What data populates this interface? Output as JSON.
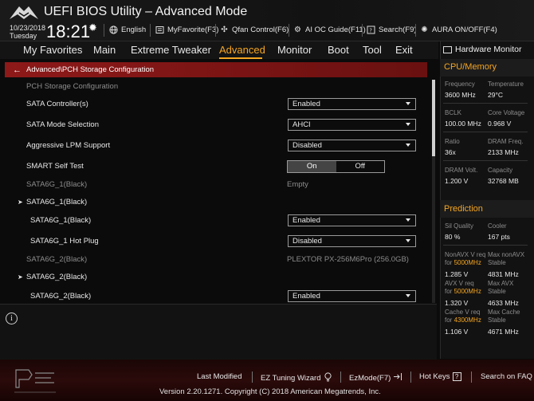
{
  "titlebar": {
    "title": "UEFI BIOS Utility – Advanced Mode",
    "date": "10/23/2018",
    "weekday": "Tuesday",
    "time": "18:21",
    "items": [
      {
        "label": "English",
        "icon": "globe-icon"
      },
      {
        "label": "MyFavorite(F3)",
        "icon": "favorite-icon"
      },
      {
        "label": "Qfan Control(F6)",
        "icon": "fan-icon"
      },
      {
        "label": "AI OC Guide(F11)",
        "icon": "ai-oc-icon"
      },
      {
        "label": "Search(F9)",
        "icon": "search-icon"
      },
      {
        "label": "AURA ON/OFF(F4)",
        "icon": "aura-icon"
      }
    ]
  },
  "menu": {
    "items": [
      "My Favorites",
      "Main",
      "Extreme Tweaker",
      "Advanced",
      "Monitor",
      "Boot",
      "Tool",
      "Exit"
    ],
    "active": "Advanced"
  },
  "breadcrumb": "Advanced\\PCH Storage Configuration",
  "section_title": "PCH Storage Configuration",
  "rows": [
    {
      "label": "SATA Controller(s)",
      "type": "select",
      "value": "Enabled"
    },
    {
      "label": "SATA Mode Selection",
      "type": "select",
      "value": "AHCI"
    },
    {
      "label": "Aggressive LPM Support",
      "type": "select",
      "value": "Disabled"
    },
    {
      "label": "SMART Self Test",
      "type": "toggle",
      "on": "On",
      "off": "Off"
    },
    {
      "label": "SATA6G_1(Black)",
      "type": "info",
      "value": "Empty"
    },
    {
      "label": "SATA6G_1(Black)",
      "type": "group"
    },
    {
      "label": "SATA6G_1(Black)",
      "type": "select",
      "value": "Enabled"
    },
    {
      "label": "SATA6G_1 Hot Plug",
      "type": "select",
      "value": "Disabled"
    },
    {
      "label": "SATA6G_2(Black)",
      "type": "info",
      "value": "PLEXTOR PX-256M6Pro (256.0GB)"
    },
    {
      "label": "SATA6G_2(Black)",
      "type": "group"
    },
    {
      "label": "SATA6G_2(Black)",
      "type": "select",
      "value": "Enabled"
    }
  ],
  "hw_monitor": {
    "title": "Hardware Monitor",
    "cpu_memory": {
      "title": "CPU/Memory",
      "frequency_label": "Frequency",
      "frequency": "3600 MHz",
      "temperature_label": "Temperature",
      "temperature": "29°C",
      "bclk_label": "BCLK",
      "bclk": "100.00 MHz",
      "core_voltage_label": "Core Voltage",
      "core_voltage": "0.968 V",
      "ratio_label": "Ratio",
      "ratio": "36x",
      "dram_freq_label": "DRAM Freq.",
      "dram_freq": "2133 MHz",
      "dram_volt_label": "DRAM Volt.",
      "dram_volt": "1.200 V",
      "capacity_label": "Capacity",
      "capacity": "32768 MB"
    },
    "prediction": {
      "title": "Prediction",
      "sil_quality_label": "Sil Quality",
      "sil_quality": "80 %",
      "cooler_label": "Cooler",
      "cooler": "167 pts",
      "nonavx_req_label": "NonAVX V req",
      "nonavx_for": "for",
      "nonavx_freq": "5000MHz",
      "nonavx_v": "1.285 V",
      "max_nonavx_label": "Max nonAVX",
      "max_nonavx_state": "Stable",
      "max_nonavx": "4831 MHz",
      "avx_req_label": "AVX V req",
      "avx_for": "for",
      "avx_freq": "5000MHz",
      "avx_v": "1.320 V",
      "max_avx_label": "Max AVX",
      "max_avx_state": "Stable",
      "max_avx": "4633 MHz",
      "cache_req_label": "Cache V req",
      "cache_for": "for",
      "cache_freq": "4300MHz",
      "cache_v": "1.106 V",
      "max_cache_label": "Max Cache",
      "max_cache_state": "Stable",
      "max_cache": "4671 MHz"
    }
  },
  "footer": {
    "last_modified": "Last Modified",
    "ez_tuning": "EZ Tuning Wizard",
    "ezmode": "EzMode(F7)",
    "hot_keys": "Hot Keys",
    "hot_keys_key": "?",
    "search_faq": "Search on FAQ",
    "version": "Version 2.20.1271. Copyright (C) 2018 American Megatrends, Inc."
  },
  "colors": {
    "accent": "#f5a623",
    "breadcrumb": "#8e1919",
    "background": "#0b0b0b"
  }
}
